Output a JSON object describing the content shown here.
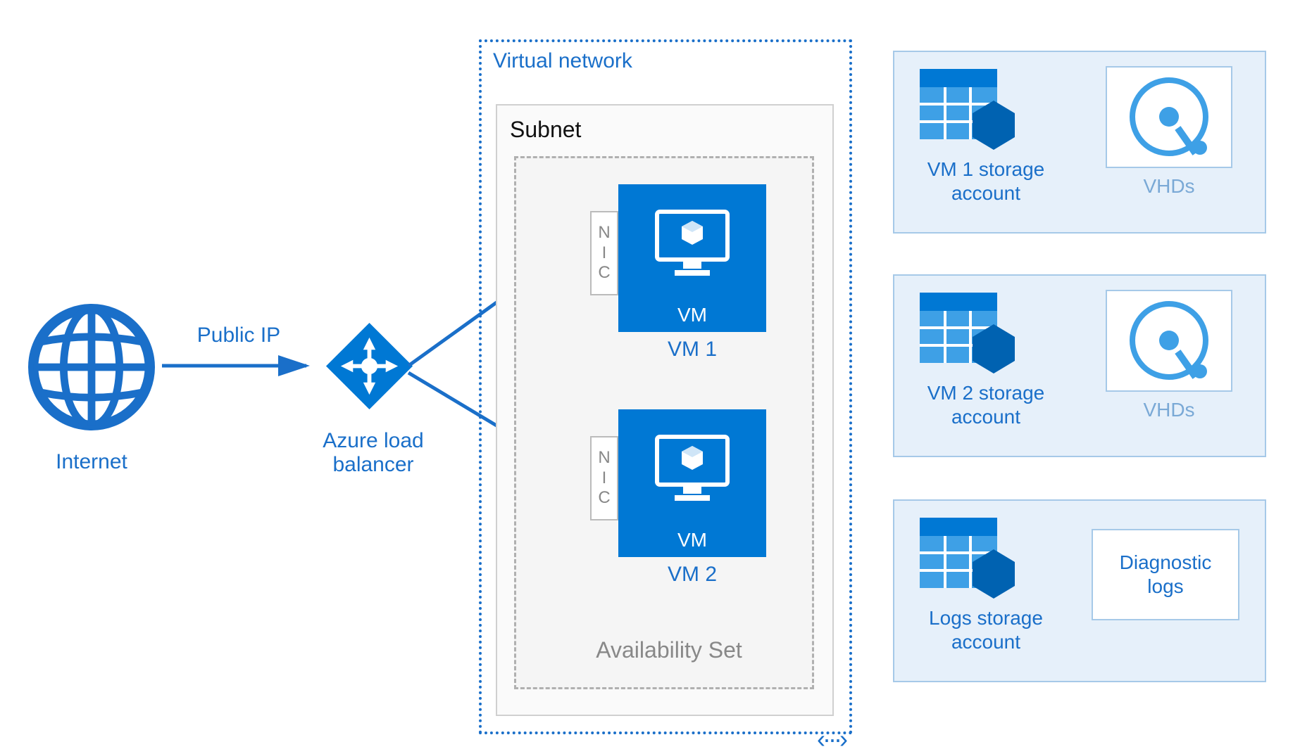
{
  "internet": {
    "label": "Internet"
  },
  "public_ip_label": "Public IP",
  "load_balancer": {
    "label": "Azure load\nbalancer"
  },
  "vnet": {
    "label": "Virtual network"
  },
  "subnet": {
    "label": "Subnet"
  },
  "availability_set": {
    "label": "Availability Set"
  },
  "vms": [
    {
      "nic": "NIC",
      "box_label": "VM",
      "label": "VM 1"
    },
    {
      "nic": "NIC",
      "box_label": "VM",
      "label": "VM 2"
    }
  ],
  "storage_panels": [
    {
      "storage_label": "VM 1 storage\naccount",
      "side_label": "VHDs",
      "side_type": "vhd"
    },
    {
      "storage_label": "VM 2 storage\naccount",
      "side_label": "VHDs",
      "side_type": "vhd"
    },
    {
      "storage_label": "Logs storage\naccount",
      "side_label": "Diagnostic\nlogs",
      "side_type": "diag"
    }
  ],
  "expand_glyph": "‹···›"
}
